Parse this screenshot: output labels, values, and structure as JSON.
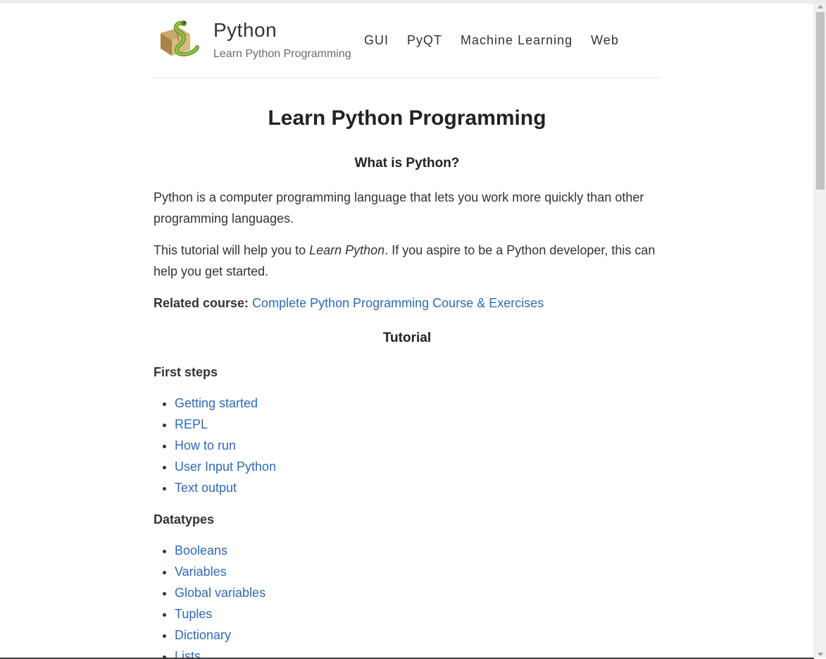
{
  "header": {
    "site_title": "Python",
    "tagline": "Learn Python Programming",
    "nav": [
      "GUI",
      "PyQT",
      "Machine Learning",
      "Web"
    ]
  },
  "main": {
    "title": "Learn Python Programming",
    "what_heading": "What is Python?",
    "intro": "Python is a computer programming language that lets you work more quickly than other programming languages.",
    "help_before": "This tutorial will help you to ",
    "help_em": "Learn Python",
    "help_after": ". If you aspire to be a Python developer, this can help you get started.",
    "related_label": "Related course:",
    "related_link": "Complete Python Programming Course & Exercises",
    "tutorial_heading": "Tutorial",
    "sections": [
      {
        "title": "First steps",
        "items": [
          "Getting started",
          "REPL",
          "How to run",
          "User Input Python",
          "Text output"
        ]
      },
      {
        "title": "Datatypes",
        "items": [
          "Booleans",
          "Variables",
          "Global variables",
          "Tuples",
          "Dictionary",
          "Lists"
        ]
      }
    ]
  },
  "colors": {
    "link": "#2f6bb4",
    "text": "#333333",
    "heading": "#222222"
  },
  "icons": {
    "logo": "python-snake-box-logo"
  }
}
